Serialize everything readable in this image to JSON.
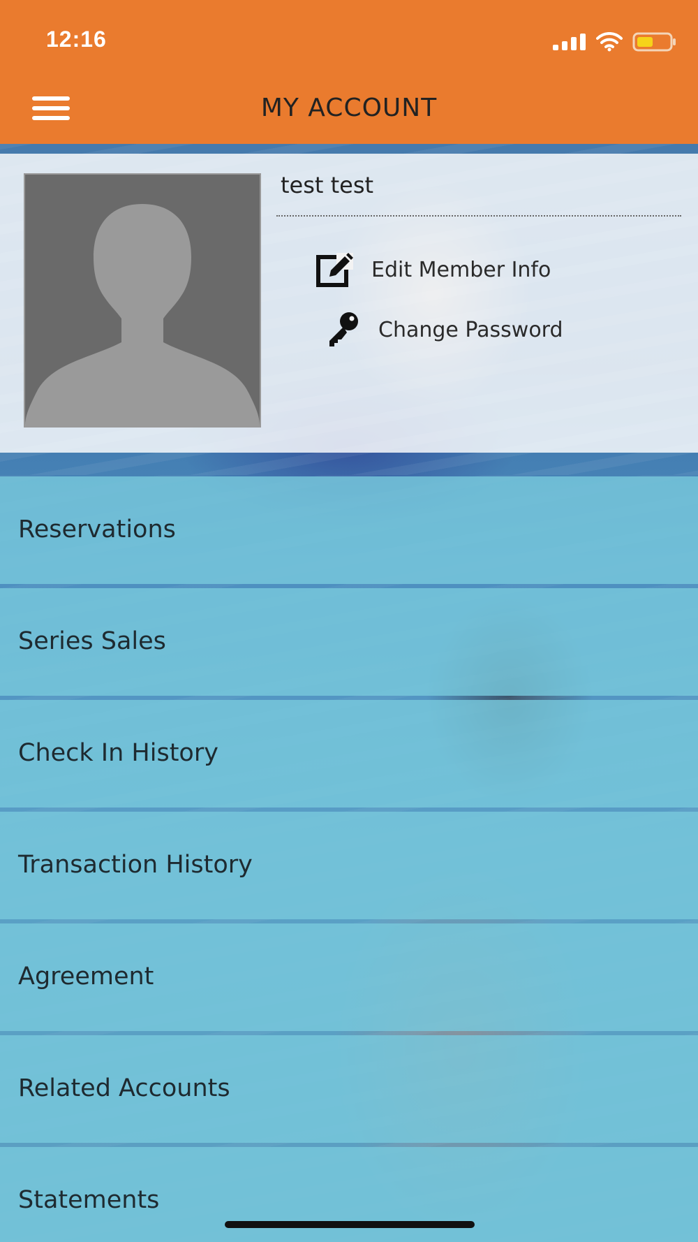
{
  "status_bar": {
    "time": "12:16"
  },
  "header": {
    "title": "MY ACCOUNT",
    "menu_icon": "hamburger-menu-icon",
    "background_color": "#ea7b2e"
  },
  "profile": {
    "name": "test test",
    "avatar_icon": "avatar-placeholder-icon",
    "actions": [
      {
        "label": "Edit Member Info",
        "icon": "edit-icon"
      },
      {
        "label": "Change Password",
        "icon": "key-icon"
      }
    ]
  },
  "menu": {
    "items": [
      {
        "label": "Reservations"
      },
      {
        "label": "Series Sales"
      },
      {
        "label": "Check In History"
      },
      {
        "label": "Transaction History"
      },
      {
        "label": "Agreement"
      },
      {
        "label": "Related Accounts"
      },
      {
        "label": "Statements"
      }
    ],
    "item_color": "#78c8dc"
  }
}
